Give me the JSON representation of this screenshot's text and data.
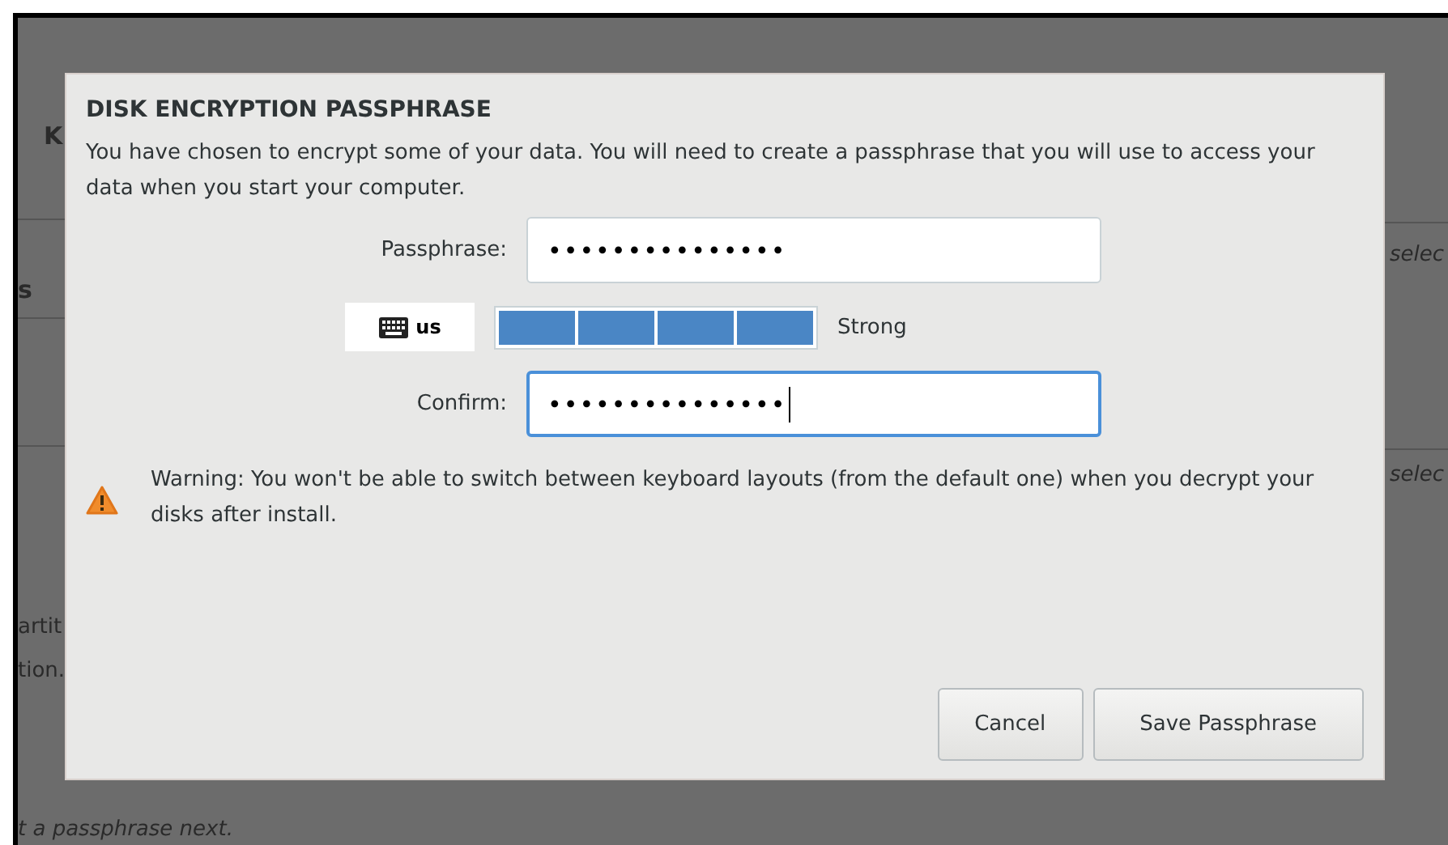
{
  "background": {
    "left_fragments": [
      {
        "text": "K",
        "kind": "heading"
      },
      {
        "text": "s",
        "kind": "heading"
      },
      {
        "text": "artit",
        "kind": "plain"
      },
      {
        "text": "tion.",
        "kind": "plain"
      }
    ],
    "right_fragments": [
      {
        "text": "selec",
        "kind": "italic"
      },
      {
        "text": "selec",
        "kind": "italic"
      }
    ],
    "footer": {
      "text": "t a passphrase next.",
      "kind": "italic"
    }
  },
  "dialog": {
    "title": "DISK ENCRYPTION PASSPHRASE",
    "description": "You have chosen to encrypt some of your data. You will need to create a passphrase that you will use to access your data when you start your computer.",
    "passphrase": {
      "label": "Passphrase:",
      "value": "•••••••••••••••",
      "focused": false
    },
    "keyboard_layout": "us",
    "strength": {
      "level": 1,
      "label": "Strong"
    },
    "confirm": {
      "label": "Confirm:",
      "value": "•••••••••••••••",
      "focused": true
    },
    "warning": "Warning: You won't be able to switch between keyboard layouts (from the default one) when you decrypt your disks after install.",
    "buttons": [
      {
        "label": "Cancel",
        "kind": "secondary"
      },
      {
        "label": "Save Passphrase",
        "kind": "primary"
      }
    ]
  }
}
